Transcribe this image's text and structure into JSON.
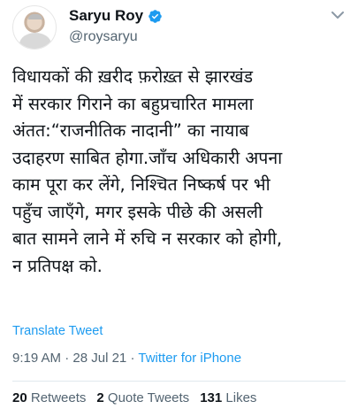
{
  "tweet": {
    "author": {
      "name": "Saryu Roy",
      "handle": "@roysaryu",
      "verified": true,
      "verified_color": "#1d9bf0"
    },
    "text_lines": [
      "विधायकों की ख़रीद फ़रोख़्त से झारखंड",
      "में सरकार गिराने का बहुप्रचारित मामला",
      "अंतत:“राजनीतिक नादानी” का नायाब",
      "उदाहरण साबित होगा.जाँच अधिकारी अपना",
      "काम पूरा कर लेंगे, निश्चित निष्कर्ष पर भी",
      "पहुँच जाएँगे, मगर इसके पीछे की असली",
      "बात सामने लाने में रुचि न सरकार को होगी,",
      "न प्रतिपक्ष को."
    ],
    "translate_label": "Translate Tweet",
    "time": "9:19 AM",
    "separator": "·",
    "date": "28 Jul 21",
    "source": "Twitter for iPhone",
    "stats": {
      "retweets_count": "20",
      "retweets_label": "Retweets",
      "quotes_count": "2",
      "quotes_label": "Quote Tweets",
      "likes_count": "131",
      "likes_label": "Likes"
    }
  },
  "icons": {
    "verified": "verified-badge-icon",
    "more": "chevron-down-icon"
  },
  "colors": {
    "link": "#1d9bf0",
    "text": "#0f1419",
    "secondary": "#536471"
  }
}
